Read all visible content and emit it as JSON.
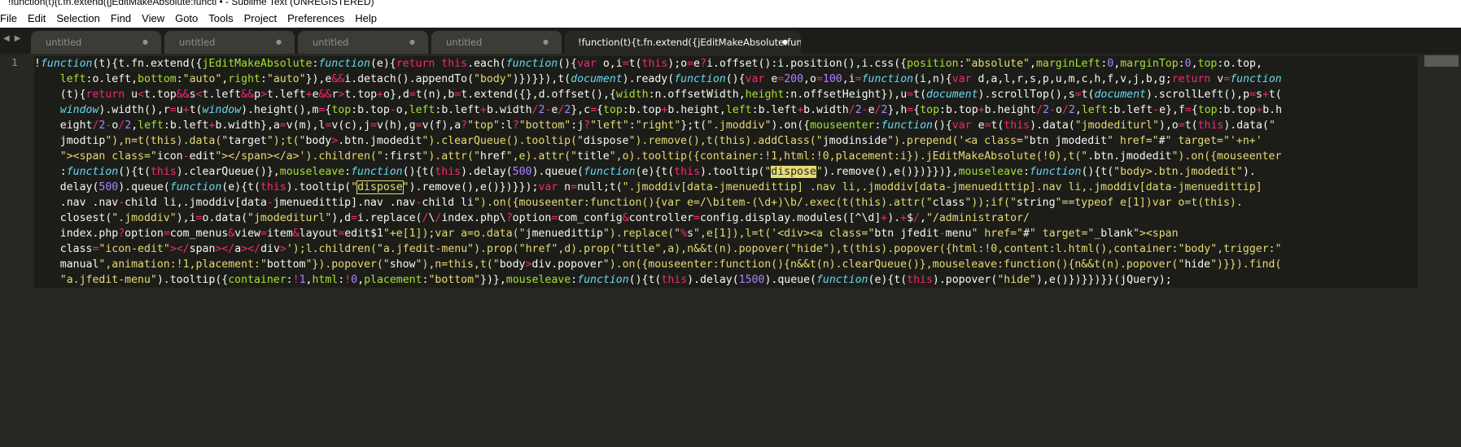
{
  "window": {
    "title": "!function(t){t.fn.extend({jEditMakeAbsolute:functi • - Sublime Text (UNREGISTERED)"
  },
  "menu": {
    "items": [
      "File",
      "Edit",
      "Selection",
      "Find",
      "View",
      "Goto",
      "Tools",
      "Project",
      "Preferences",
      "Help"
    ]
  },
  "tabs": [
    {
      "label": "untitled",
      "active": false
    },
    {
      "label": "untitled",
      "active": false
    },
    {
      "label": "untitled",
      "active": false
    },
    {
      "label": "untitled",
      "active": false
    },
    {
      "label": "!function(t){t.fn.extend({jEditMakeAbsolute:functi",
      "active": true
    }
  ],
  "tab_nav": {
    "left": "◀",
    "right": "▶"
  },
  "editor": {
    "line_number": "1",
    "code_lines": [
      "!function(t){t.fn.extend({jEditMakeAbsolute:function(e){return this.each(function(){var o,i=t(this);o=e?i.offset():i.position(),i.css({position:\"absolute\",marginLeft:0,marginTop:0,top:o.top,",
      "    left:o.left,bottom:\"auto\",right:\"auto\"}),e&&i.detach().appendTo(\"body\")})}}),t(document).ready(function(){var e=200,o=100,i=function(i,n){var d,a,l,r,s,p,u,m,c,h,f,v,j,b,g;return v=function",
      "    (t){return u<t.top&&s<t.left&&p>t.left+e&&r>t.top+o},d=t(n),b=t.extend({},d.offset(),{width:n.offsetWidth,height:n.offsetHeight}),u=t(document).scrollTop(),s=t(document).scrollLeft(),p=s+t(",
      "    window).width(),r=u+t(window).height(),m={top:b.top-o,left:b.left+b.width/2-e/2},c={top:b.top+b.height,left:b.left+b.width/2-e/2},h={top:b.top+b.height/2-o/2,left:b.left-e},f={top:b.top+b.h",
      "    eight/2-o/2,left:b.left+b.width},a=v(m),l=v(c),j=v(h),g=v(f),a?\"top\":l?\"bottom\":j?\"left\":\"right\"};t(\".jmoddiv\").on({mouseenter:function(){var e=t(this).data(\"jmodediturl\"),o=t(this).data(\"",
      "    jmodtip\"),n=t(this).data(\"target\");t(\"body>.btn.jmodedit\").clearQueue().tooltip(\"dispose\").remove(),t(this).addClass(\"jmodinside\").prepend('<a class=\"btn jmodedit\" href=\"#\" target=\"'+n+'",
      "    \"><span class=\"icon-edit\"></span></a>').children(\":first\").attr(\"href\",e).attr(\"title\",o).tooltip({container:!1,html:!0,placement:i}).jEditMakeAbsolute(!0),t(\".btn.jmodedit\").on({mouseenter",
      "    :function(){t(this).clearQueue()},mouseleave:function(){t(this).delay(500).queue(function(e){t(this).tooltip(\"dispose\").remove(),e()})}})},mouseleave:function(){t(\"body>.btn.jmodedit\").",
      "    delay(500).queue(function(e){t(this).tooltip(\"dispose\").remove(),e()})}});var n=null;t(\".jmoddiv[data-jmenuedittip] .nav li,.jmoddiv[data-jmenuedittip].nav li,.jmoddiv[data-jmenuedittip]",
      "    .nav .nav-child li,.jmoddiv[data-jmenuedittip].nav .nav-child li\").on({mouseenter:function(){var e=/\\bitem-(\\d+)\\b/.exec(t(this).attr(\"class\"));if(\"string\"==typeof e[1])var o=t(this).",
      "    closest(\".jmoddiv\"),i=o.data(\"jmodediturl\"),d=i.replace(/\\/index.php\\?option=com_config&controller=config.display.modules([^\\d]+).+$/,\"/administrator/",
      "    index.php?option=com_menus&view=item&layout=edit$1\"+e[1]);var a=o.data(\"jmenuedittip\").replace(\"%s\",e[1]),l=t('<div><a class=\"btn jfedit-menu\" href=\"#\" target=\"_blank\"><span",
      "    class=\"icon-edit\"></span></a></div>');l.children(\"a.jfedit-menu\").prop(\"href\",d).prop(\"title\",a),n&&t(n).popover(\"hide\"),t(this).popover({html:!0,content:l.html(),container:\"body\",trigger:\"",
      "    manual\",animation:!1,placement:\"bottom\"}).popover(\"show\"),n=this,t(\"body>div.popover\").on({mouseenter:function(){n&&t(n).clearQueue()},mouseleave:function(){n&&t(n).popover(\"hide\")}}).find(",
      "    \"a.jfedit-menu\").tooltip({container:!1,html:!0,placement:\"bottom\"})},mouseleave:function(){t(this).delay(1500).queue(function(e){t(this).popover(\"hide\"),e()})}})}}(jQuery);"
    ]
  }
}
